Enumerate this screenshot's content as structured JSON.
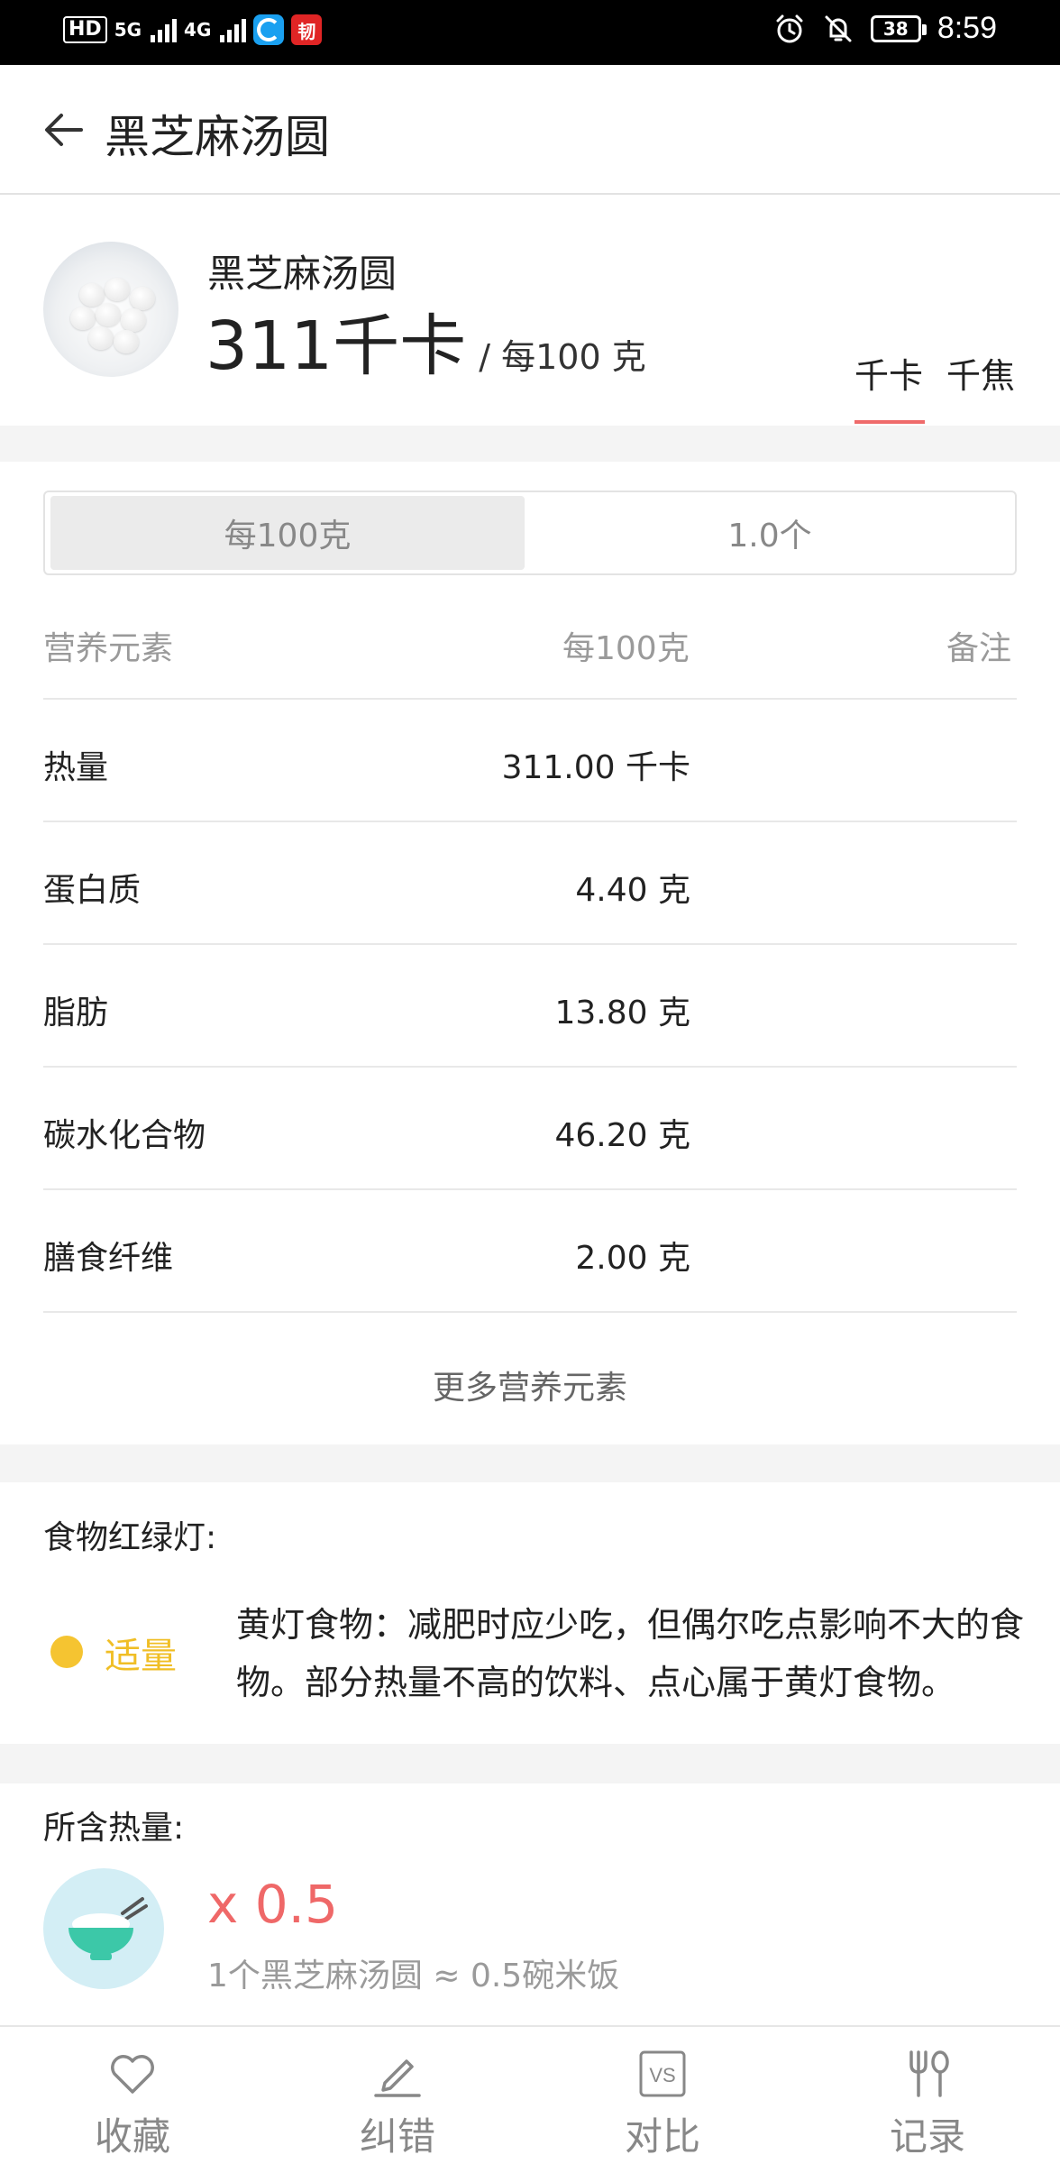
{
  "status_bar": {
    "hd": "HD",
    "signal1": "5G",
    "signal2": "4G",
    "app_badge": "韧",
    "battery": "38",
    "time": "8:59"
  },
  "app_bar": {
    "title": "黑芝麻汤圆"
  },
  "header": {
    "food_name": "黑芝麻汤圆",
    "calories": "311千卡",
    "per_unit": "/ 每100 克",
    "unit_tabs": [
      "千卡",
      "千焦"
    ],
    "active_unit": "千卡"
  },
  "serving": {
    "options": [
      "每100克",
      "1.0个"
    ],
    "active": "每100克"
  },
  "nutrients": {
    "headers": {
      "name": "营养元素",
      "per": "每100克",
      "note": "备注"
    },
    "rows": [
      {
        "name": "热量",
        "value": "311.00 千卡"
      },
      {
        "name": "蛋白质",
        "value": "4.40 克"
      },
      {
        "name": "脂肪",
        "value": "13.80 克"
      },
      {
        "name": "碳水化合物",
        "value": "46.20 克"
      },
      {
        "name": "膳食纤维",
        "value": "2.00 克"
      }
    ],
    "more_label": "更多营养元素"
  },
  "traffic_light": {
    "title": "食物红绿灯:",
    "level": "适量",
    "level_color": "#F5C431",
    "description": "黄灯食物：减肥时应少吃，但偶尔吃点影响不大的食物。部分热量不高的饮料、点心属于黄灯食物。"
  },
  "calorie_equiv": {
    "title": "所含热量:",
    "icon": "rice-bowl-icon",
    "multiplier": "x 0.5",
    "description": "1个黑芝麻汤圆 ≈ 0.5碗米饭"
  },
  "bottom_nav": [
    {
      "label": "收藏",
      "icon": "heart-icon"
    },
    {
      "label": "纠错",
      "icon": "pencil-icon"
    },
    {
      "label": "对比",
      "icon": "vs-icon"
    },
    {
      "label": "记录",
      "icon": "fork-spoon-icon"
    }
  ],
  "colors": {
    "accent_red": "#EF6A6A",
    "yellow": "#F5C431",
    "rice_bg": "#D3EEF5",
    "rice_bowl": "#3CC8A8"
  }
}
